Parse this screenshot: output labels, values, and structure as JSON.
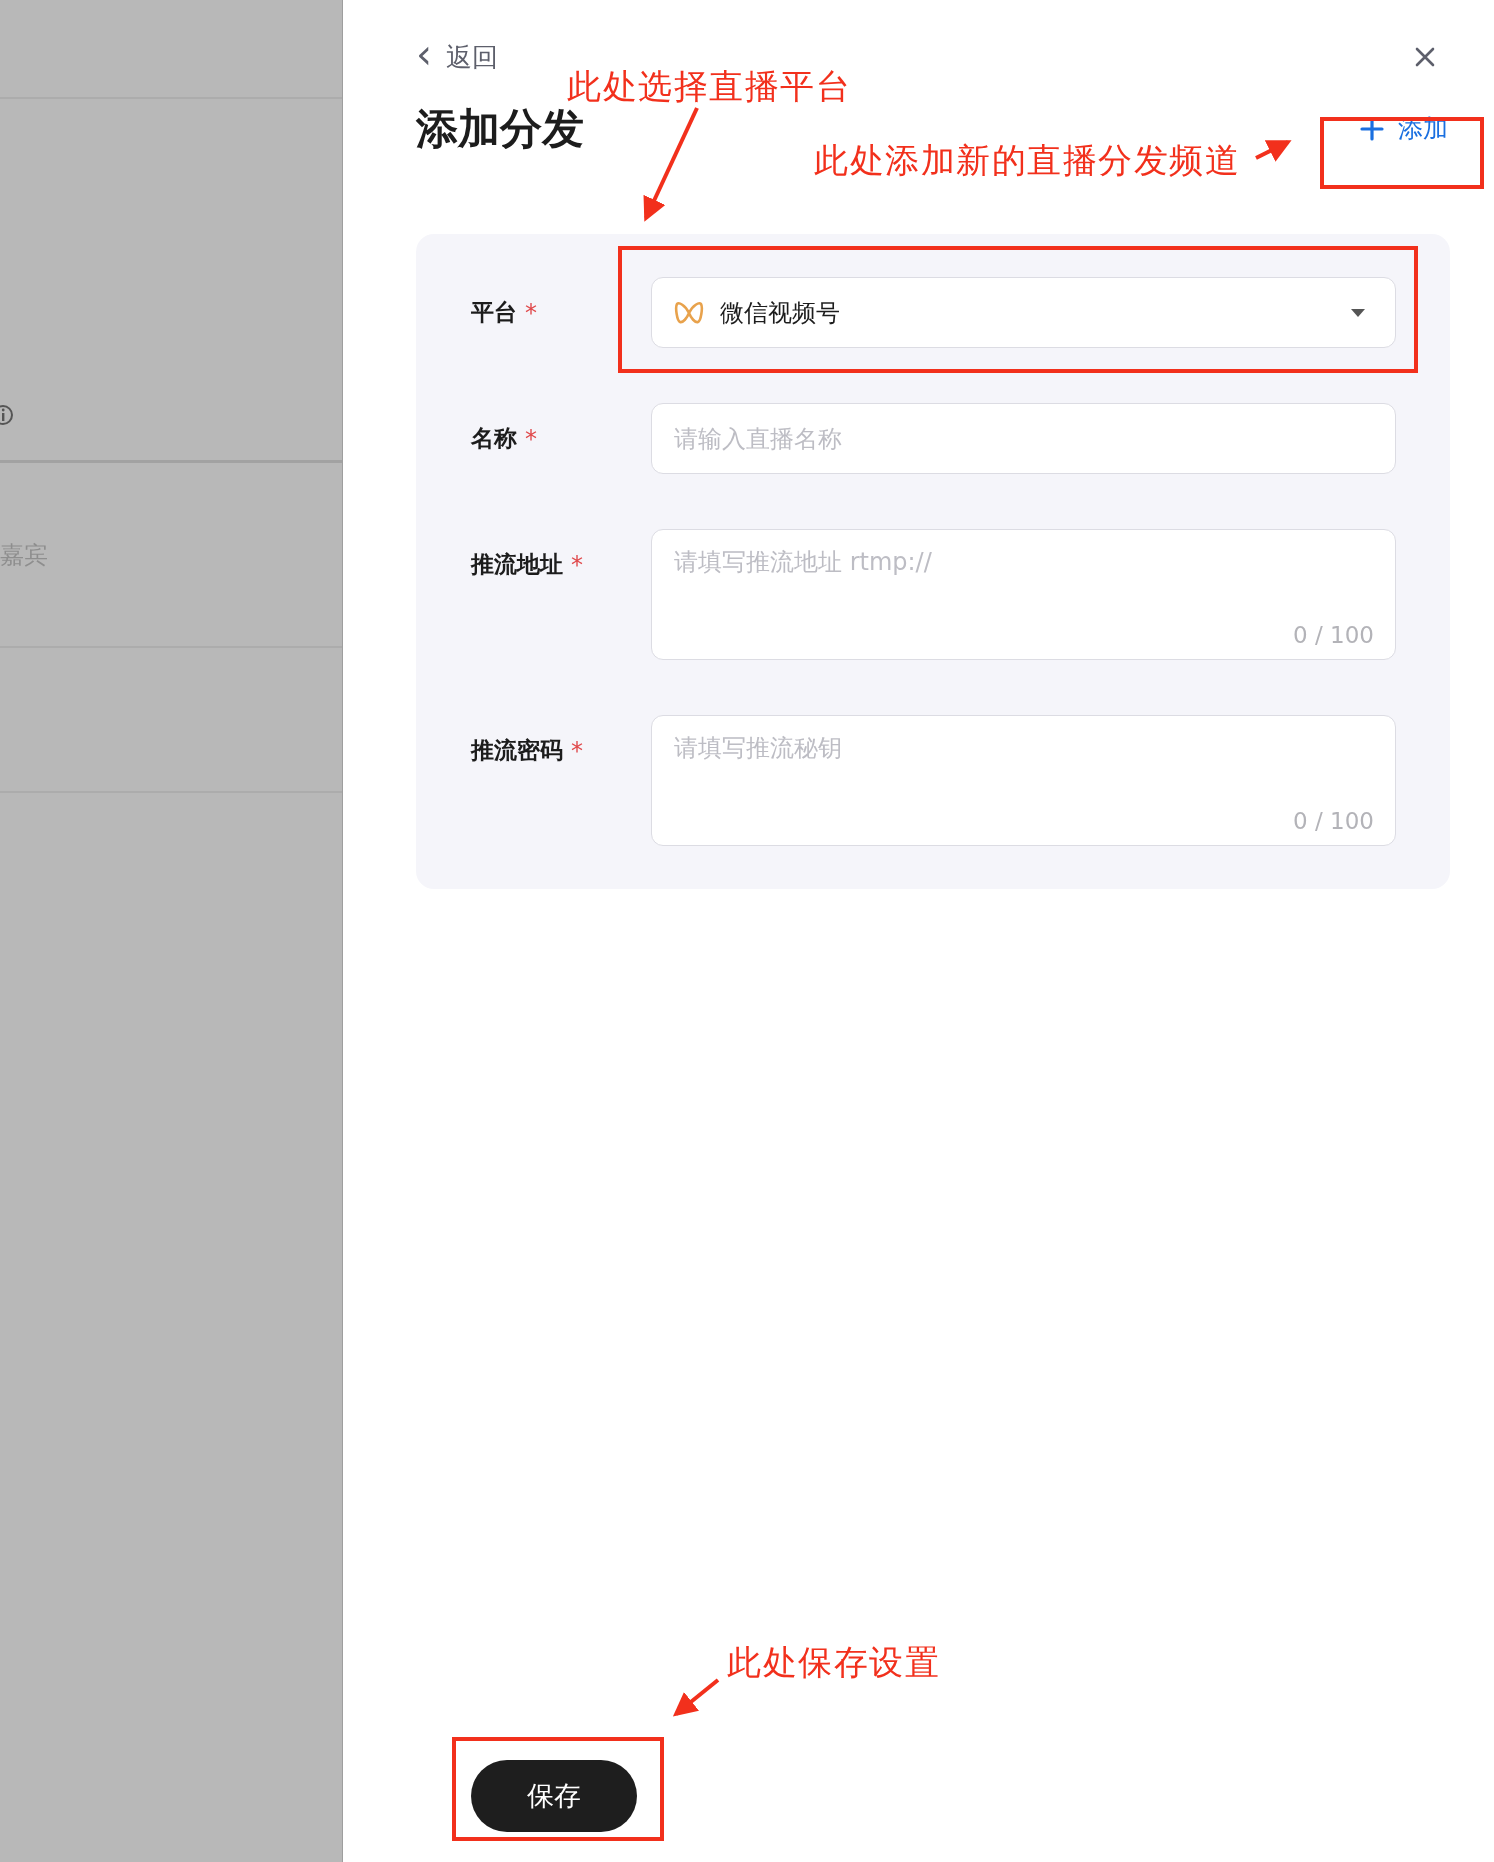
{
  "background_panel": {
    "text": "嘉宾"
  },
  "drawer": {
    "back": {
      "icon": "‹",
      "label": "返回"
    },
    "title": "添加分发",
    "add_button": {
      "label": "添加"
    },
    "fields": [
      {
        "kind": "select",
        "label": "平台",
        "required_mark": "*",
        "value": "微信视频号"
      },
      {
        "kind": "input",
        "label": "名称",
        "required_mark": "*",
        "placeholder": "请输入直播名称"
      },
      {
        "kind": "textarea",
        "label": "推流地址",
        "required_mark": "*",
        "placeholder": "请填写推流地址 rtmp://",
        "counter": "0 / 100"
      },
      {
        "kind": "textarea",
        "label": "推流密码",
        "required_mark": "*",
        "placeholder": "请填写推流秘钥",
        "counter": "0 / 100"
      }
    ],
    "save_button": {
      "label": "保存"
    }
  },
  "annotations": [
    {
      "text": "此处选择直播平台"
    },
    {
      "text": "此处添加新的直播分发频道"
    },
    {
      "text": "此处保存设置"
    }
  ]
}
